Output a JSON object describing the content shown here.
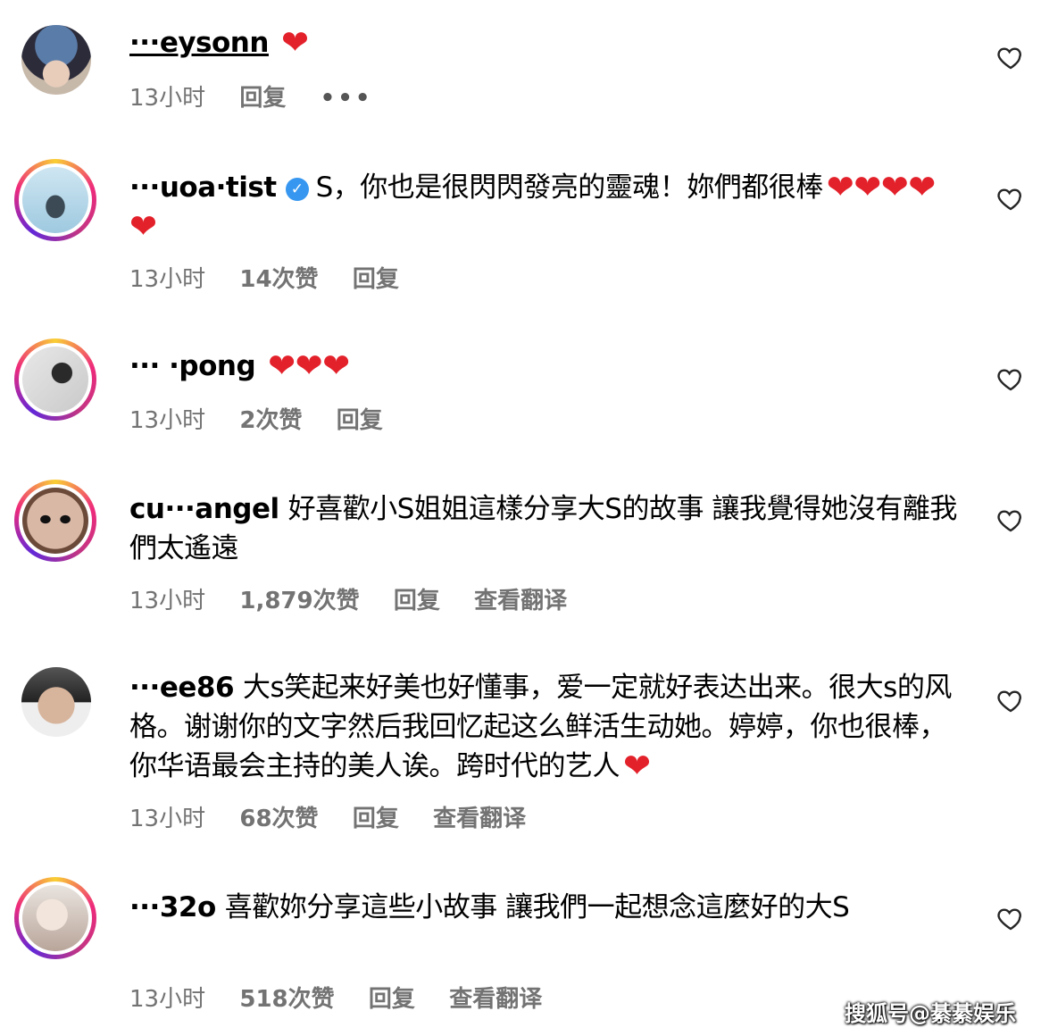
{
  "comments": [
    {
      "username": "···eysonn",
      "text": "",
      "hearts": "❤",
      "meta": {
        "time": "13小时",
        "likes": "",
        "reply": "回复",
        "translate": "",
        "more": "•••"
      }
    },
    {
      "username": "···uoa·tist",
      "verified": true,
      "text": "S，你也是很閃閃發亮的靈魂！妳們都很棒",
      "hearts": "❤❤❤❤❤",
      "meta": {
        "time": "13小时",
        "likes": "14次赞",
        "reply": "回复",
        "translate": ""
      }
    },
    {
      "username": "··· ·pong",
      "text": "",
      "hearts": "❤❤❤",
      "meta": {
        "time": "13小时",
        "likes": "2次赞",
        "reply": "回复",
        "translate": ""
      }
    },
    {
      "username": "cu···angel",
      "text": "好喜歡小S姐姐這樣分享大S的故事 讓我覺得她沒有離我們太遙遠",
      "hearts": "",
      "meta": {
        "time": "13小时",
        "likes": "1,879次赞",
        "reply": "回复",
        "translate": "查看翻译"
      }
    },
    {
      "username": "···ee86",
      "text": "大s笑起来好美也好懂事，爱一定就好表达出来。很大s的风格。谢谢你的文字然后我回忆起这么鲜活生动她。婷婷，你也很棒，你华语最会主持的美人诶。跨时代的艺人",
      "hearts": "❤",
      "meta": {
        "time": "13小时",
        "likes": "68次赞",
        "reply": "回复",
        "translate": "查看翻译"
      }
    },
    {
      "username": "···32o",
      "text": "喜歡妳分享這些小故事 讓我們一起想念這麼好的大S",
      "hearts": "",
      "meta": {
        "time": "13小时",
        "likes": "518次赞",
        "reply": "回复",
        "translate": "查看翻译"
      }
    }
  ],
  "icons": {
    "like": "heart-outline-icon",
    "verified": "verified-badge-icon"
  },
  "colors": {
    "meta": "#737373",
    "heart": "#e3212b",
    "verified": "#3797f0"
  },
  "watermark": "搜狐号@綦綦娱乐"
}
